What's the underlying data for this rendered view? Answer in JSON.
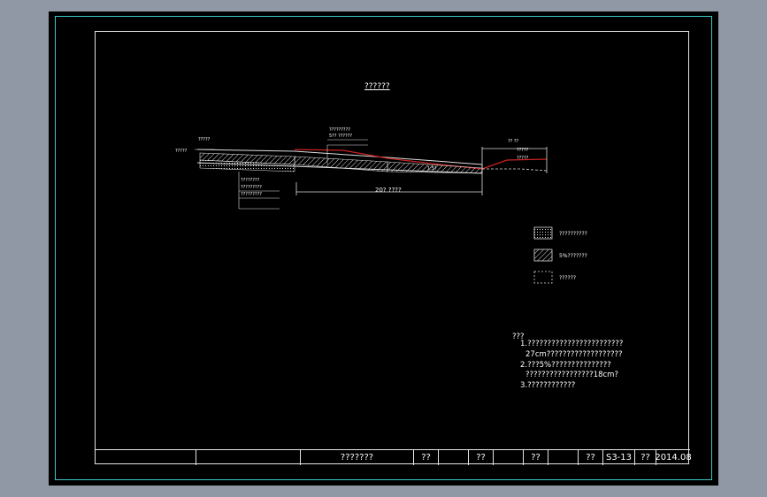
{
  "drawing": {
    "title": "??????",
    "labels": {
      "left_edge": "?????",
      "left_top": "?????",
      "mid_top_1": "?????????",
      "mid_top_2": "5?? ??????",
      "left_bottom_1": "????????",
      "left_bottom_2": "?????????",
      "left_bottom_3": "?????????",
      "right_top": "?? ??",
      "right_mid": "?????",
      "right_mid_2": "?????",
      "dimension": "20? ????",
      "slope": "1:5?"
    },
    "legend": [
      {
        "icon": "dotted-hatch-icon",
        "text": "??????????"
      },
      {
        "icon": "diagonal-hatch-icon",
        "text": "5%???????"
      },
      {
        "icon": "dashed-box-icon",
        "text": "??????"
      }
    ],
    "notes": {
      "heading": "???",
      "items": [
        "1.????????????????????????",
        "27cm???????????????????",
        "2.???5%???????????????",
        "?????????????????18cm?",
        "3.????????????"
      ]
    },
    "title_block": {
      "cells": [
        "",
        "",
        "???????",
        "??",
        "",
        "??",
        "",
        "??",
        "",
        "??",
        "S3-13",
        "??",
        "2014.08"
      ]
    }
  }
}
